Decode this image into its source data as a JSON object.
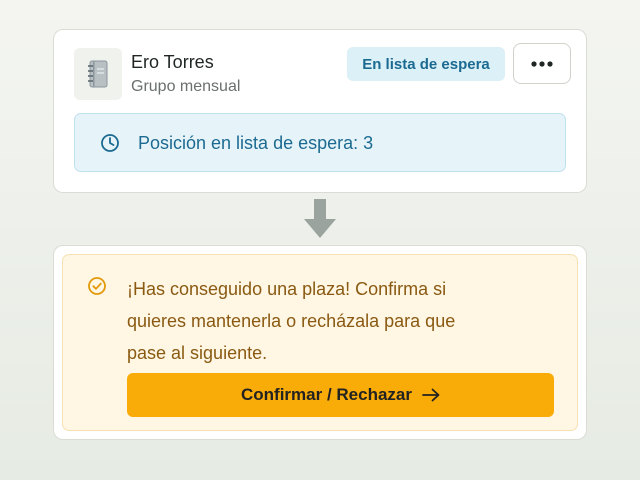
{
  "card": {
    "avatar_icon": "notebook-icon",
    "name": "Ero Torres",
    "group": "Grupo mensual",
    "status_badge": "En lista de espera",
    "more_icon": "more-horizontal-icon"
  },
  "waitlist": {
    "icon": "clock-icon",
    "text": "Posición en lista de espera: 3"
  },
  "transition_icon": "arrow-down-icon",
  "notice": {
    "icon": "check-circle-icon",
    "line1": "¡Has conseguido una plaza! Confirma si",
    "line2": "quieres mantenerla o recházala para que",
    "line3": "pase al siguiente.",
    "button_label": "Confirmar / Rechazar",
    "button_icon": "arrow-right-icon"
  },
  "colors": {
    "badge_bg": "#dcf0f7",
    "badge_text": "#1b6a92",
    "info_bg": "#e6f4f9",
    "notice_bg": "#fff6e3",
    "notice_text": "#8a5a12",
    "accent": "#f9ac08"
  }
}
